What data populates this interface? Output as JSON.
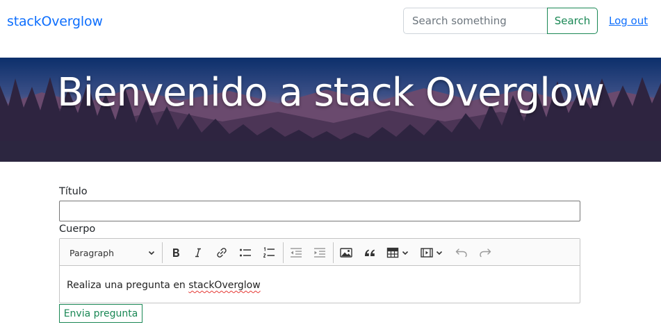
{
  "navbar": {
    "brand": "stackOverglow",
    "search_placeholder": "Search something",
    "search_button": "Search",
    "logout": "Log out"
  },
  "banner": {
    "title": "Bienvenido a stack Overglow"
  },
  "form": {
    "title_label": "Título",
    "title_value": "",
    "body_label": "Cuerpo",
    "editor": {
      "heading_select": "Paragraph",
      "toolbar_icons": [
        "bold-icon",
        "italic-icon",
        "link-icon",
        "bulleted-list-icon",
        "numbered-list-icon",
        "outdent-icon",
        "indent-icon",
        "image-icon",
        "blockquote-icon",
        "table-icon",
        "media-icon",
        "undo-icon",
        "redo-icon"
      ],
      "content_prefix": "Realiza una pregunta en ",
      "content_misspelled": "stackOverglow"
    },
    "submit_button": "Envia pregunta"
  },
  "colors": {
    "brand": "#0d6efd",
    "success": "#198754",
    "spellcheck": "#e53935"
  }
}
